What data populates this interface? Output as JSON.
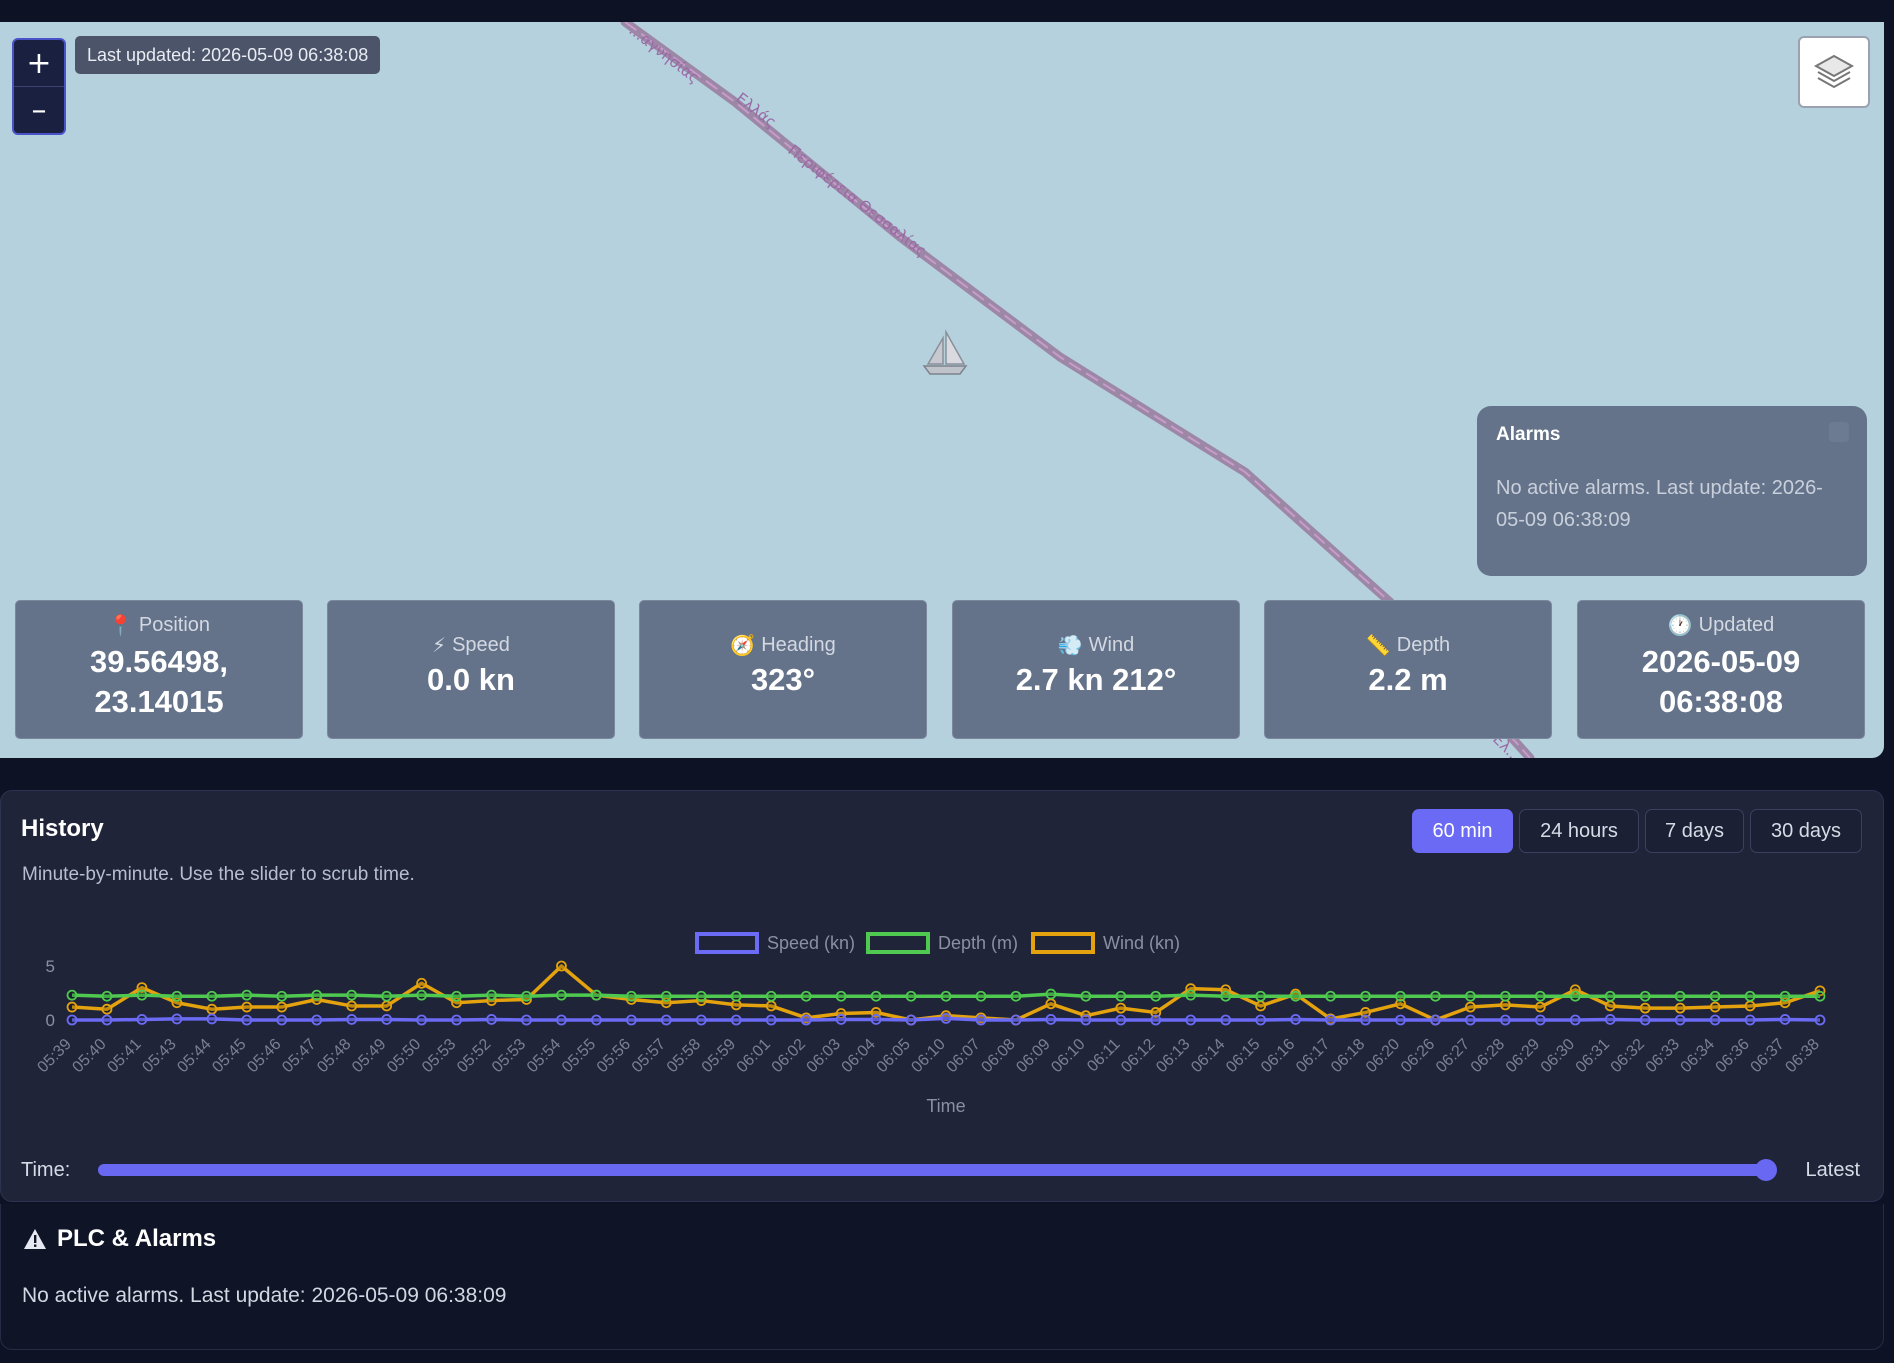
{
  "map": {
    "last_updated": "Last updated: 2026-05-09 06:38:08",
    "zoom_in": "+",
    "zoom_out": "–",
    "road_labels": [
      "...αγνησίας",
      "Ελλάς",
      "Περιφέρεια Θεσσαλίας",
      "Ελ..."
    ]
  },
  "alarms_popup": {
    "title": "Alarms",
    "body": "No active alarms. Last update: 2026-05-09 06:38:09"
  },
  "cards": [
    {
      "icon": "pin-icon",
      "label": "Position",
      "value1": "39.56498,",
      "value2": "23.14015"
    },
    {
      "icon": "lightning-icon",
      "label": "Speed",
      "value1": "0.0 kn"
    },
    {
      "icon": "compass-icon",
      "label": "Heading",
      "value1": "323°"
    },
    {
      "icon": "wind-icon",
      "label": "Wind",
      "value1": "2.7 kn 212°"
    },
    {
      "icon": "ruler-icon",
      "label": "Depth",
      "value1": "2.2 m"
    },
    {
      "icon": "clock-icon",
      "label": "Updated",
      "value1": "2026-05-09",
      "value2": "06:38:08"
    }
  ],
  "history": {
    "title": "History",
    "subtitle": "Minute-by-minute. Use the slider to scrub time.",
    "ranges": [
      "60 min",
      "24 hours",
      "7 days",
      "30 days"
    ],
    "active_range": "60 min"
  },
  "chart_data": {
    "type": "line",
    "xlabel": "Time",
    "ylabel": "",
    "ylim": [
      0,
      5
    ],
    "yticks": [
      0,
      5
    ],
    "legend_position": "top-center",
    "categories": [
      "05:39",
      "05:40",
      "05:41",
      "05:43",
      "05:44",
      "05:45",
      "05:46",
      "05:47",
      "05:48",
      "05:49",
      "05:50",
      "05:53",
      "05:52",
      "05:53",
      "05:54",
      "05:55",
      "05:56",
      "05:57",
      "05:58",
      "05:59",
      "06:01",
      "06:02",
      "06:03",
      "06:04",
      "06:05",
      "06:10",
      "06:07",
      "06:08",
      "06:09",
      "06:10",
      "06:11",
      "06:12",
      "06:13",
      "06:14",
      "06:15",
      "06:16",
      "06:17",
      "06:18",
      "06:20",
      "06:26",
      "06:27",
      "06:28",
      "06:29",
      "06:30",
      "06:31",
      "06:32",
      "06:33",
      "06:34",
      "06:36",
      "06:37",
      "06:38"
    ],
    "series": [
      {
        "name": "Speed (kn)",
        "color": "#6b6bf5",
        "values": [
          0,
          0,
          0.05,
          0.1,
          0.1,
          0,
          0,
          0,
          0.05,
          0.05,
          0,
          0,
          0.05,
          0,
          0,
          0,
          0,
          0,
          0,
          0,
          0,
          0,
          0.05,
          0.05,
          0,
          0.15,
          0,
          0,
          0.05,
          0,
          0,
          0,
          0,
          0,
          0,
          0.05,
          0,
          0,
          0,
          0,
          0,
          0,
          0,
          0,
          0.05,
          0,
          0,
          0,
          0,
          0.05,
          0
        ]
      },
      {
        "name": "Depth (m)",
        "color": "#4fc94f",
        "values": [
          2.3,
          2.2,
          2.3,
          2.2,
          2.2,
          2.3,
          2.2,
          2.3,
          2.3,
          2.2,
          2.3,
          2.2,
          2.3,
          2.2,
          2.3,
          2.3,
          2.2,
          2.2,
          2.2,
          2.2,
          2.2,
          2.2,
          2.2,
          2.2,
          2.2,
          2.2,
          2.2,
          2.2,
          2.4,
          2.2,
          2.2,
          2.2,
          2.3,
          2.2,
          2.2,
          2.2,
          2.2,
          2.2,
          2.2,
          2.2,
          2.2,
          2.2,
          2.2,
          2.2,
          2.2,
          2.2,
          2.2,
          2.2,
          2.2,
          2.2,
          2.2
        ]
      },
      {
        "name": "Wind (kn)",
        "color": "#e3a20e",
        "values": [
          1.2,
          1.0,
          3.0,
          1.6,
          1.0,
          1.2,
          1.2,
          1.9,
          1.3,
          1.3,
          3.4,
          1.6,
          1.8,
          1.9,
          5.0,
          2.3,
          1.9,
          1.6,
          1.8,
          1.4,
          1.3,
          0.2,
          0.6,
          0.7,
          0.0,
          0.4,
          0.2,
          0.0,
          1.5,
          0.4,
          1.1,
          0.7,
          2.9,
          2.8,
          1.3,
          2.4,
          0.1,
          0.7,
          1.5,
          0.0,
          1.2,
          1.4,
          1.2,
          2.8,
          1.3,
          1.1,
          1.1,
          1.2,
          1.3,
          1.6,
          2.7
        ]
      }
    ]
  },
  "slider": {
    "label": "Time:",
    "right_label": "Latest",
    "position": 1.0
  },
  "plc": {
    "title": "PLC & Alarms",
    "message": "No active alarms. Last update: 2026-05-09 06:38:09"
  }
}
